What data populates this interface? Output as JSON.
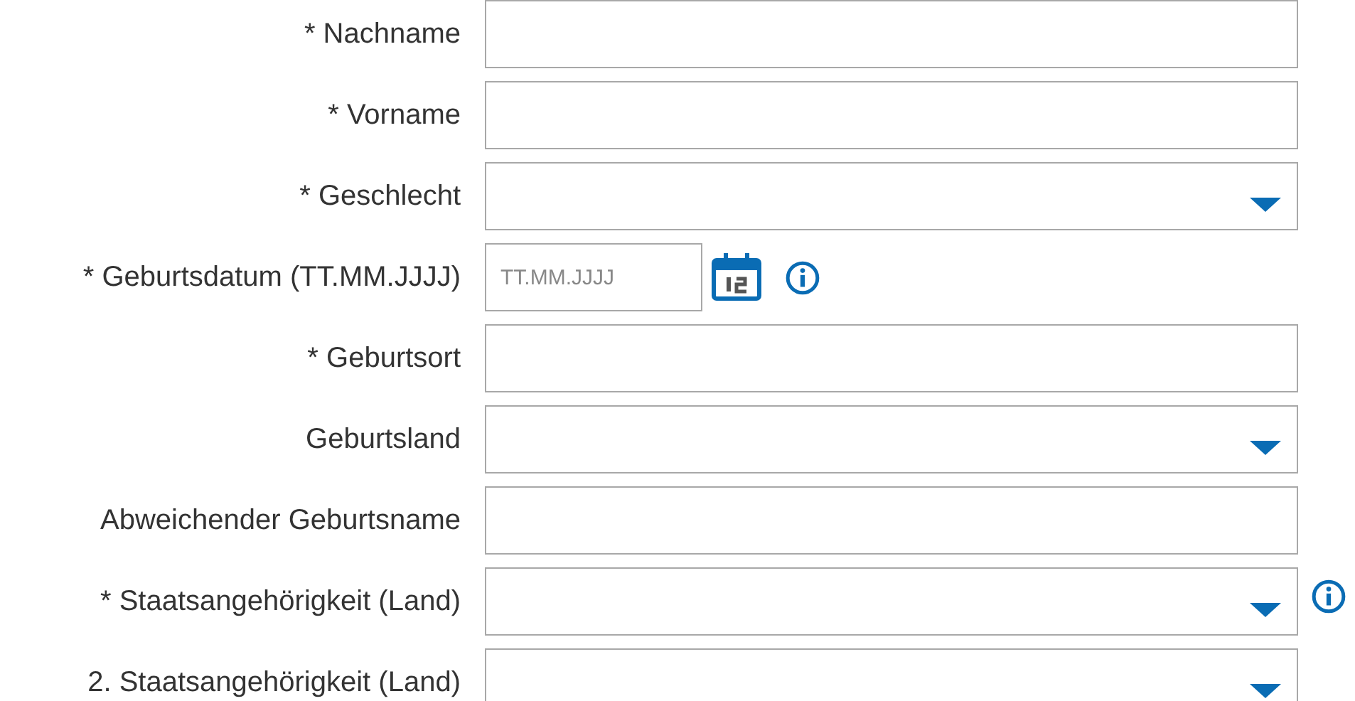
{
  "fields": [
    {
      "label": "* Nachname",
      "kind": "text",
      "info": false
    },
    {
      "label": "* Vorname",
      "kind": "text",
      "info": false
    },
    {
      "label": "* Geschlecht",
      "kind": "select",
      "info": false
    },
    {
      "label": "* Geburtsdatum (TT.MM.JJJJ)",
      "kind": "date",
      "placeholder": "TT.MM.JJJJ",
      "info": true
    },
    {
      "label": "* Geburtsort",
      "kind": "text",
      "info": false
    },
    {
      "label": "Geburtsland",
      "kind": "select",
      "info": false
    },
    {
      "label": "Abweichender Geburtsname",
      "kind": "text",
      "info": false
    },
    {
      "label": "* Staatsangehörigkeit (Land)",
      "kind": "select",
      "info": true
    },
    {
      "label": "2. Staatsangehörigkeit (Land)",
      "kind": "select",
      "info": false
    }
  ]
}
